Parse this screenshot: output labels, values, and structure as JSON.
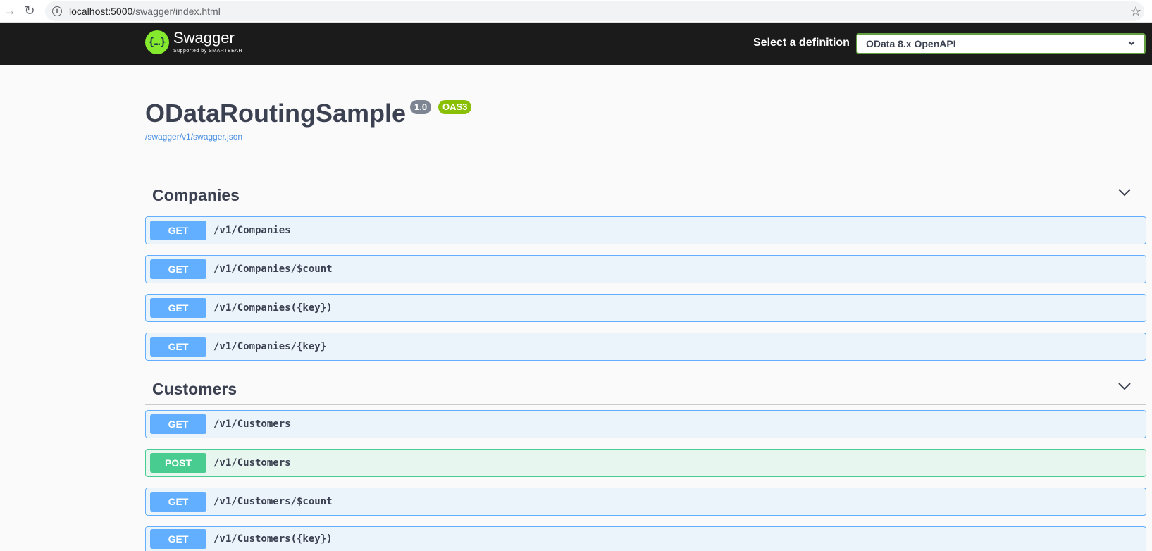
{
  "browser": {
    "url_host": "localhost:5000",
    "url_path": "/swagger/index.html"
  },
  "topbar": {
    "logo_title": "Swagger",
    "logo_subtitle": "Supported by SMARTBEAR",
    "definition_label": "Select a definition",
    "definition_selected": "OData 8.x OpenAPI"
  },
  "info": {
    "title": "ODataRoutingSample",
    "version": "1.0",
    "oas": "OAS3",
    "spec_link": "/swagger/v1/swagger.json"
  },
  "sections": [
    {
      "name": "Companies",
      "operations": [
        {
          "method": "GET",
          "path": "/v1/Companies"
        },
        {
          "method": "GET",
          "path": "/v1/Companies/$count"
        },
        {
          "method": "GET",
          "path": "/v1/Companies({key})"
        },
        {
          "method": "GET",
          "path": "/v1/Companies/{key}"
        }
      ]
    },
    {
      "name": "Customers",
      "operations": [
        {
          "method": "GET",
          "path": "/v1/Customers"
        },
        {
          "method": "POST",
          "path": "/v1/Customers"
        },
        {
          "method": "GET",
          "path": "/v1/Customers/$count"
        },
        {
          "method": "GET",
          "path": "/v1/Customers({key})"
        }
      ]
    }
  ],
  "colors": {
    "get": "#61affe",
    "post": "#49cc90",
    "topbar": "#1b1b1b",
    "logo": "#85ea2d"
  }
}
